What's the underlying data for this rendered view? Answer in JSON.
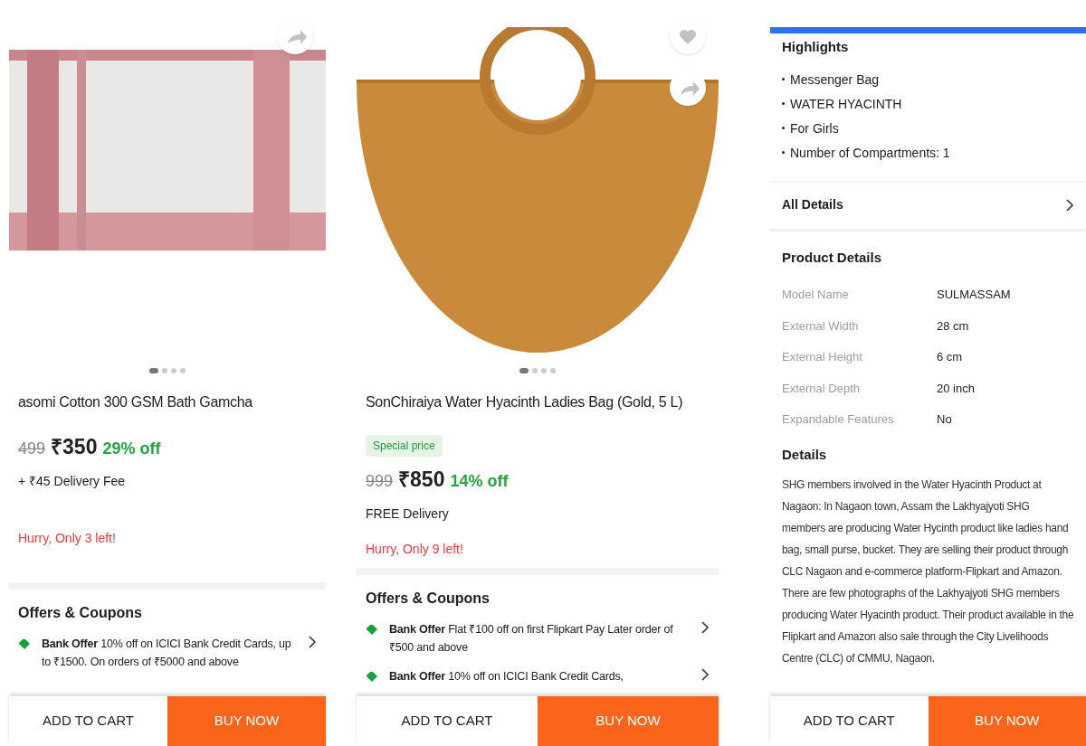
{
  "panels": [
    {
      "kind": "product",
      "image": {
        "kind": "towel"
      },
      "actions": [
        {
          "kind": "share"
        }
      ],
      "dots": [
        {
          "selected": true
        },
        {
          "selected": false
        },
        {
          "selected": false
        },
        {
          "selected": false
        }
      ],
      "title": "asomi Cotton 300 GSM Bath Gamcha",
      "mrp": "499",
      "price": "₹350",
      "discount": "29% off",
      "delivery": "+ ₹45 Delivery Fee",
      "stock": "Hurry, Only 3 left!",
      "offers_heading": "Offers & Coupons",
      "offers": [
        {
          "label": "Bank Offer",
          "text": "10% off on ICICI Bank Credit Cards, up to ₹1500. On orders of ₹5000 and above"
        }
      ],
      "add_to_cart": "ADD TO CART",
      "buy_now": "BUY NOW"
    },
    {
      "kind": "product",
      "image": {
        "kind": "bag"
      },
      "actions": [
        {
          "kind": "wishlist"
        },
        {
          "kind": "share"
        }
      ],
      "dots": [
        {
          "selected": true
        },
        {
          "selected": false
        },
        {
          "selected": false
        },
        {
          "selected": false
        }
      ],
      "title": "SonChiraiya Water Hyacinth Ladies Bag (Gold, 5 L)",
      "badge": "Special price",
      "mrp": "999",
      "price": "₹850",
      "discount": "14% off",
      "delivery": "FREE Delivery",
      "stock": "Hurry, Only 9 left!",
      "offers_heading": "Offers & Coupons",
      "offers": [
        {
          "label": "Bank Offer",
          "text": "Flat ₹100 off on first Flipkart Pay Later order of ₹500 and above"
        },
        {
          "label": "Bank Offer",
          "text": "10% off on ICICI Bank Credit Cards,"
        }
      ],
      "add_to_cart": "ADD TO CART",
      "buy_now": "BUY NOW"
    },
    {
      "kind": "details",
      "highlights_heading": "Highlights",
      "highlights": [
        "Messenger Bag",
        "WATER HYACINTH",
        "For Girls",
        "Number of Compartments: 1"
      ],
      "all_details": "All Details",
      "product_details_heading": "Product Details",
      "specs": [
        {
          "label": "Model Name",
          "value": "SULMASSAM"
        },
        {
          "label": "External Width",
          "value": "28 cm"
        },
        {
          "label": "External Height",
          "value": "6 cm"
        },
        {
          "label": "External Depth",
          "value": "20 inch"
        },
        {
          "label": "Expandable Features",
          "value": "No"
        }
      ],
      "details_heading": "Details",
      "details_text": "SHG members involved in the Water Hyacinth Product at Nagaon: In Nagaon town, Assam the Lakhyajyoti SHG members are producing Water Hycinth product like ladies hand bag, small purse, bucket. They are selling their product through CLC Nagaon and e-commerce platform-Flipkart and Amazon. There are few photographs of the Lakhyajyoti SHG members producing Water Hyacinth product. Their product available in the Flipkart and Amazon also sale through the City Livelihoods Centre (CLC) of CMMU, Nagaon.",
      "add_to_cart": "ADD TO CART",
      "buy_now": "BUY NOW"
    }
  ]
}
